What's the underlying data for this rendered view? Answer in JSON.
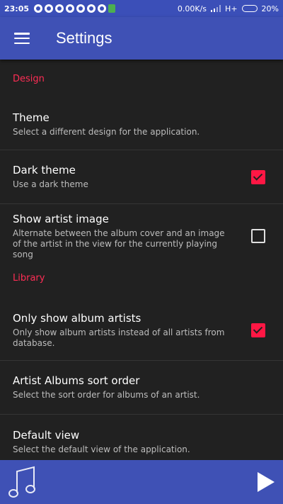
{
  "status_bar": {
    "time": "23:05",
    "net_speed": "0.00K/s",
    "network": "H+",
    "battery": "20%",
    "notification_icons": [
      "whatsapp-icon",
      "whatsapp-icon",
      "whatsapp-icon",
      "whatsapp-icon",
      "whatsapp-icon",
      "whatsapp-icon",
      "whatsapp-icon",
      "app-icon"
    ]
  },
  "app_bar": {
    "title": "Settings",
    "menu_icon": "menu-icon"
  },
  "sections": {
    "design": {
      "header": "Design",
      "theme": {
        "title": "Theme",
        "summary": "Select a different design for the application."
      },
      "dark_theme": {
        "title": "Dark theme",
        "summary": "Use a dark theme",
        "checked": true
      },
      "show_artist_image": {
        "title": "Show artist image",
        "summary": "Alternate between the album cover and an image of the artist in the view for the currently playing song",
        "checked": false
      }
    },
    "library": {
      "header": "Library",
      "only_album_artists": {
        "title": "Only show album artists",
        "summary": "Only show album artists instead of all artists from database.",
        "checked": true
      },
      "artist_albums_sort": {
        "title": "Artist Albums sort order",
        "summary": "Select the sort order for albums of an artist."
      },
      "default_view": {
        "title": "Default view",
        "summary": "Select the default view of the application."
      }
    }
  },
  "bottom_bar": {
    "album_art_icon": "music-note-icon",
    "play_icon": "play-icon"
  },
  "colors": {
    "primary": "#3f51b5",
    "accent": "#ff1744",
    "background": "#212121"
  }
}
